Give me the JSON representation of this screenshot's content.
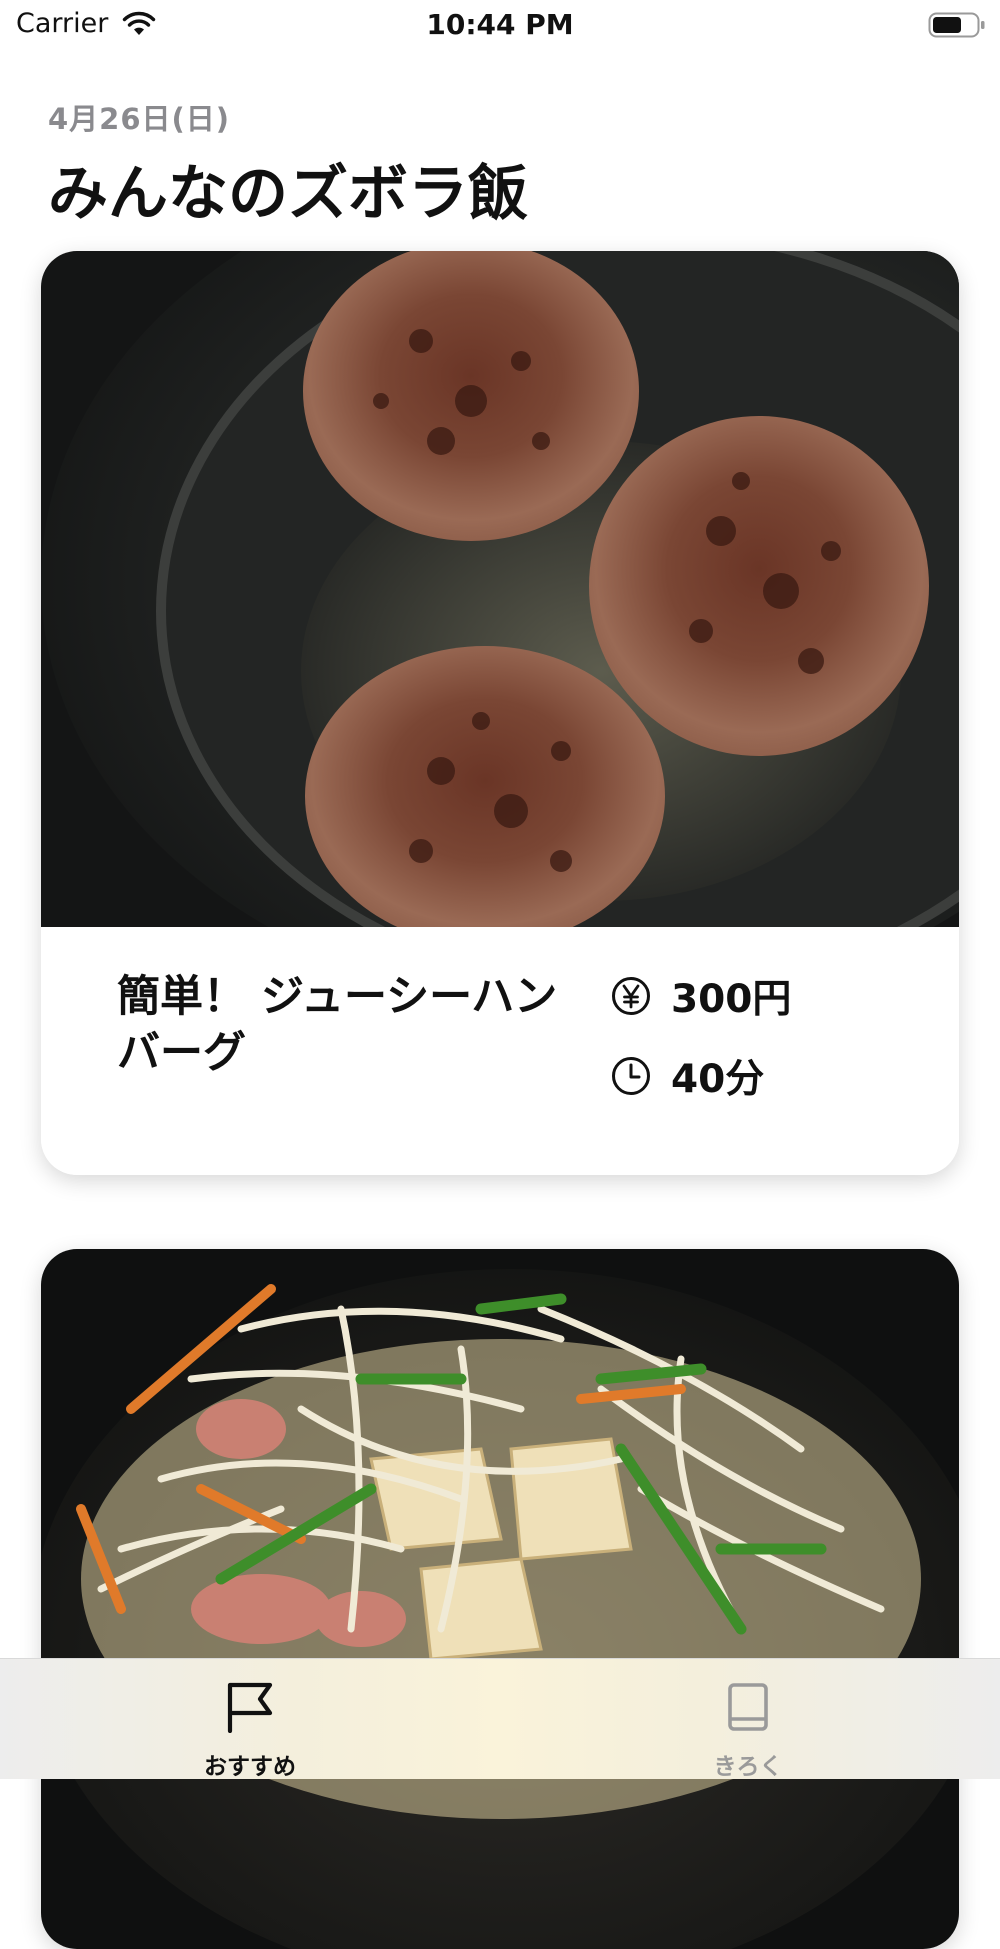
{
  "status_bar": {
    "carrier": "Carrier",
    "time": "10:44 PM",
    "wifi_icon": "wifi-icon",
    "battery_icon": "battery-icon"
  },
  "header": {
    "date": "4月26日(日)",
    "title": "みんなのズボラ飯"
  },
  "recipes": [
    {
      "title": "簡単！ ジューシーハンバーグ",
      "price": "300円",
      "time": "40分",
      "photo": "hamburger-steaks-in-pan",
      "price_icon": "yen-icon",
      "time_icon": "clock-icon"
    },
    {
      "photo": "stir-fried-vegetables-tofu"
    }
  ],
  "tab_bar": {
    "tabs": [
      {
        "label": "おすすめ",
        "icon": "flag-icon",
        "active": true
      },
      {
        "label": "きろく",
        "icon": "book-icon",
        "active": false
      }
    ]
  },
  "colors": {
    "date_gray": "#8a8a8e",
    "active_tab": "#111111",
    "inactive_tab": "#9a9a9a"
  }
}
